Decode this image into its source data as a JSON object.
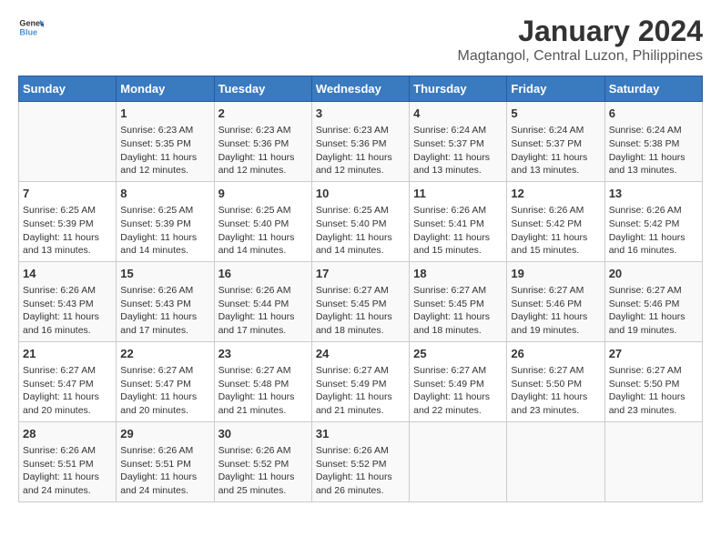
{
  "logo": {
    "general": "General",
    "blue": "Blue"
  },
  "title": "January 2024",
  "subtitle": "Magtangol, Central Luzon, Philippines",
  "days_of_week": [
    "Sunday",
    "Monday",
    "Tuesday",
    "Wednesday",
    "Thursday",
    "Friday",
    "Saturday"
  ],
  "weeks": [
    [
      {
        "day": "",
        "content": ""
      },
      {
        "day": "1",
        "content": "Sunrise: 6:23 AM\nSunset: 5:35 PM\nDaylight: 11 hours and 12 minutes."
      },
      {
        "day": "2",
        "content": "Sunrise: 6:23 AM\nSunset: 5:36 PM\nDaylight: 11 hours and 12 minutes."
      },
      {
        "day": "3",
        "content": "Sunrise: 6:23 AM\nSunset: 5:36 PM\nDaylight: 11 hours and 12 minutes."
      },
      {
        "day": "4",
        "content": "Sunrise: 6:24 AM\nSunset: 5:37 PM\nDaylight: 11 hours and 13 minutes."
      },
      {
        "day": "5",
        "content": "Sunrise: 6:24 AM\nSunset: 5:37 PM\nDaylight: 11 hours and 13 minutes."
      },
      {
        "day": "6",
        "content": "Sunrise: 6:24 AM\nSunset: 5:38 PM\nDaylight: 11 hours and 13 minutes."
      }
    ],
    [
      {
        "day": "7",
        "content": "Sunrise: 6:25 AM\nSunset: 5:39 PM\nDaylight: 11 hours and 13 minutes."
      },
      {
        "day": "8",
        "content": "Sunrise: 6:25 AM\nSunset: 5:39 PM\nDaylight: 11 hours and 14 minutes."
      },
      {
        "day": "9",
        "content": "Sunrise: 6:25 AM\nSunset: 5:40 PM\nDaylight: 11 hours and 14 minutes."
      },
      {
        "day": "10",
        "content": "Sunrise: 6:25 AM\nSunset: 5:40 PM\nDaylight: 11 hours and 14 minutes."
      },
      {
        "day": "11",
        "content": "Sunrise: 6:26 AM\nSunset: 5:41 PM\nDaylight: 11 hours and 15 minutes."
      },
      {
        "day": "12",
        "content": "Sunrise: 6:26 AM\nSunset: 5:42 PM\nDaylight: 11 hours and 15 minutes."
      },
      {
        "day": "13",
        "content": "Sunrise: 6:26 AM\nSunset: 5:42 PM\nDaylight: 11 hours and 16 minutes."
      }
    ],
    [
      {
        "day": "14",
        "content": "Sunrise: 6:26 AM\nSunset: 5:43 PM\nDaylight: 11 hours and 16 minutes."
      },
      {
        "day": "15",
        "content": "Sunrise: 6:26 AM\nSunset: 5:43 PM\nDaylight: 11 hours and 17 minutes."
      },
      {
        "day": "16",
        "content": "Sunrise: 6:26 AM\nSunset: 5:44 PM\nDaylight: 11 hours and 17 minutes."
      },
      {
        "day": "17",
        "content": "Sunrise: 6:27 AM\nSunset: 5:45 PM\nDaylight: 11 hours and 18 minutes."
      },
      {
        "day": "18",
        "content": "Sunrise: 6:27 AM\nSunset: 5:45 PM\nDaylight: 11 hours and 18 minutes."
      },
      {
        "day": "19",
        "content": "Sunrise: 6:27 AM\nSunset: 5:46 PM\nDaylight: 11 hours and 19 minutes."
      },
      {
        "day": "20",
        "content": "Sunrise: 6:27 AM\nSunset: 5:46 PM\nDaylight: 11 hours and 19 minutes."
      }
    ],
    [
      {
        "day": "21",
        "content": "Sunrise: 6:27 AM\nSunset: 5:47 PM\nDaylight: 11 hours and 20 minutes."
      },
      {
        "day": "22",
        "content": "Sunrise: 6:27 AM\nSunset: 5:47 PM\nDaylight: 11 hours and 20 minutes."
      },
      {
        "day": "23",
        "content": "Sunrise: 6:27 AM\nSunset: 5:48 PM\nDaylight: 11 hours and 21 minutes."
      },
      {
        "day": "24",
        "content": "Sunrise: 6:27 AM\nSunset: 5:49 PM\nDaylight: 11 hours and 21 minutes."
      },
      {
        "day": "25",
        "content": "Sunrise: 6:27 AM\nSunset: 5:49 PM\nDaylight: 11 hours and 22 minutes."
      },
      {
        "day": "26",
        "content": "Sunrise: 6:27 AM\nSunset: 5:50 PM\nDaylight: 11 hours and 23 minutes."
      },
      {
        "day": "27",
        "content": "Sunrise: 6:27 AM\nSunset: 5:50 PM\nDaylight: 11 hours and 23 minutes."
      }
    ],
    [
      {
        "day": "28",
        "content": "Sunrise: 6:26 AM\nSunset: 5:51 PM\nDaylight: 11 hours and 24 minutes."
      },
      {
        "day": "29",
        "content": "Sunrise: 6:26 AM\nSunset: 5:51 PM\nDaylight: 11 hours and 24 minutes."
      },
      {
        "day": "30",
        "content": "Sunrise: 6:26 AM\nSunset: 5:52 PM\nDaylight: 11 hours and 25 minutes."
      },
      {
        "day": "31",
        "content": "Sunrise: 6:26 AM\nSunset: 5:52 PM\nDaylight: 11 hours and 26 minutes."
      },
      {
        "day": "",
        "content": ""
      },
      {
        "day": "",
        "content": ""
      },
      {
        "day": "",
        "content": ""
      }
    ]
  ]
}
